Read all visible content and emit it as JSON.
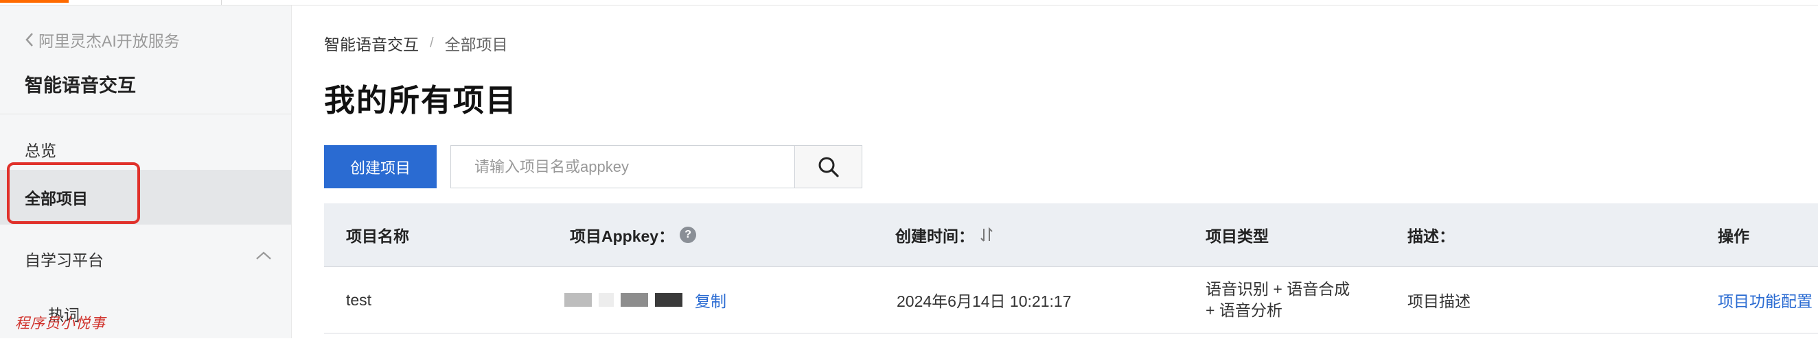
{
  "sidebar": {
    "back_label": "阿里灵杰AI开放服务",
    "product_title": "智能语音交互",
    "items": [
      {
        "label": "总览"
      },
      {
        "label": "全部项目"
      },
      {
        "label": "自学习平台"
      },
      {
        "label": "热词"
      }
    ]
  },
  "watermark": "程序员小悦事",
  "breadcrumb": {
    "root": "智能语音交互",
    "separator": "/",
    "current": "全部项目"
  },
  "page_title": "我的所有项目",
  "toolbar": {
    "create_label": "创建项目",
    "search_placeholder": "请输入项目名或appkey"
  },
  "table": {
    "headers": {
      "name": "项目名称",
      "appkey": "项目Appkey：",
      "created": "创建时间：",
      "type": "项目类型",
      "desc": "描述：",
      "ops": "操作"
    },
    "help_glyph": "?",
    "rows": [
      {
        "name": "test",
        "appkey_copy": "复制",
        "created": "2024年6月14日 10:21:17",
        "type_line1": "语音识别 + 语音合成",
        "type_line2": "+ 语音分析",
        "desc": "项目描述",
        "op": "项目功能配置"
      }
    ]
  },
  "colors": {
    "accent_orange": "#ff6a00",
    "primary_blue": "#2a6bd2",
    "highlight_red": "#e0312b"
  }
}
